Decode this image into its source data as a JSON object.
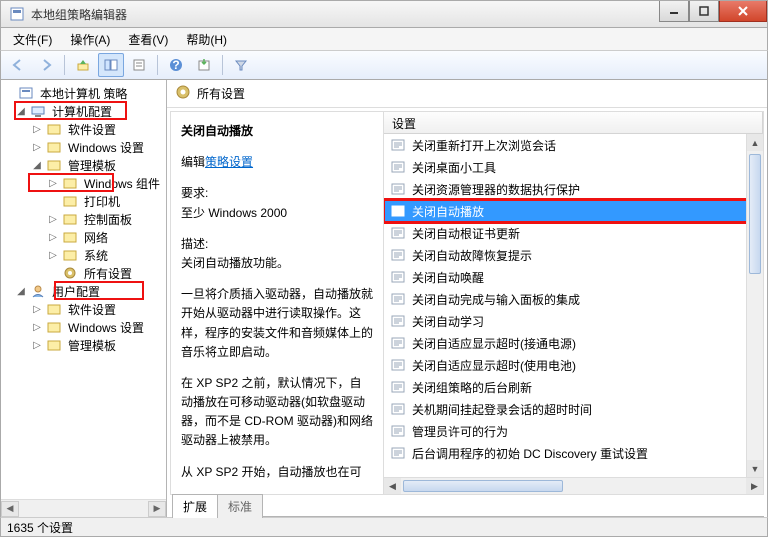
{
  "window": {
    "title": "本地组策略编辑器"
  },
  "menu": {
    "file": "文件(F)",
    "action": "操作(A)",
    "view": "查看(V)",
    "help": "帮助(H)"
  },
  "tree": {
    "root": "本地计算机 策略",
    "computer": "计算机配置",
    "c_soft": "软件设置",
    "c_win": "Windows 设置",
    "admin": "管理模板",
    "a_wincomp": "Windows 组件",
    "a_printer": "打印机",
    "a_cp": "控制面板",
    "a_net": "网络",
    "a_sys": "系统",
    "a_all": "所有设置",
    "user": "用户配置",
    "u_soft": "软件设置",
    "u_win": "Windows 设置",
    "u_admin": "管理模板"
  },
  "right": {
    "header": "所有设置",
    "policy_name": "关闭自动播放",
    "edit_label": "编辑",
    "edit_link": "策略设置",
    "req_label": "要求:",
    "req_value": "至少 Windows 2000",
    "desc_label": "描述:",
    "desc_1": "关闭自动播放功能。",
    "desc_2": "一旦将介质插入驱动器，自动播放就开始从驱动器中进行读取操作。这样，程序的安装文件和音频媒体上的音乐将立即启动。",
    "desc_3": "在 XP SP2 之前，默认情况下，自动播放在可移动驱动器(如软盘驱动器，而不是 CD-ROM 驱动器)和网络驱动器上被禁用。",
    "desc_4": "从 XP SP2 开始，自动播放也在可",
    "col_setting": "设置",
    "settings": [
      "关闭重新打开上次浏览会话",
      "关闭桌面小工具",
      "关闭资源管理器的数据执行保护",
      "关闭自动播放",
      "关闭自动根证书更新",
      "关闭自动故障恢复提示",
      "关闭自动唤醒",
      "关闭自动完成与输入面板的集成",
      "关闭自动学习",
      "关闭自适应显示超时(接通电源)",
      "关闭自适应显示超时(使用电池)",
      "关闭组策略的后台刷新",
      "关机期间挂起登录会话的超时时间",
      "管理员许可的行为",
      "后台调用程序的初始 DC Discovery 重试设置"
    ],
    "selected_index": 3
  },
  "tabs": {
    "ext": "扩展",
    "std": "标准"
  },
  "status": "1635 个设置"
}
